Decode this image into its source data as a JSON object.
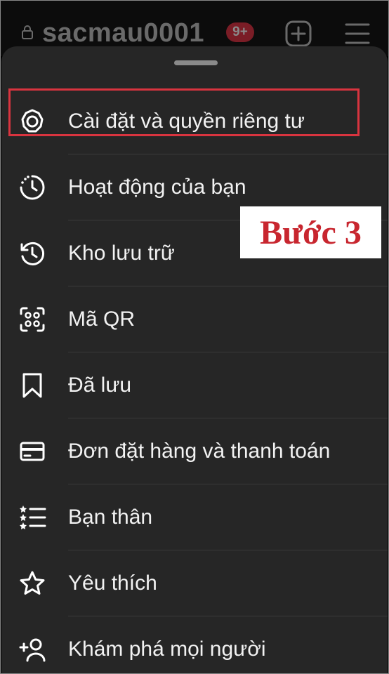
{
  "header": {
    "username": "sacmau0001",
    "notification_badge": "9+",
    "lock_icon": "lock-icon",
    "add_icon": "plus-square-icon",
    "menu_icon": "hamburger-menu-icon"
  },
  "menu": {
    "items": [
      {
        "label": "Cài đặt và quyền riêng tư",
        "icon": "settings-gear-icon"
      },
      {
        "label": "Hoạt động của bạn",
        "icon": "activity-clock-icon"
      },
      {
        "label": "Kho lưu trữ",
        "icon": "archive-history-icon"
      },
      {
        "label": "Mã QR",
        "icon": "qr-code-icon"
      },
      {
        "label": "Đã lưu",
        "icon": "bookmark-icon"
      },
      {
        "label": "Đơn đặt hàng và thanh toán",
        "icon": "credit-card-icon"
      },
      {
        "label": "Bạn thân",
        "icon": "close-friends-list-icon"
      },
      {
        "label": "Yêu thích",
        "icon": "star-icon"
      },
      {
        "label": "Khám phá mọi người",
        "icon": "add-person-icon"
      }
    ]
  },
  "annotation": {
    "step_label": "Bước 3",
    "highlight_color": "#d9343f"
  }
}
